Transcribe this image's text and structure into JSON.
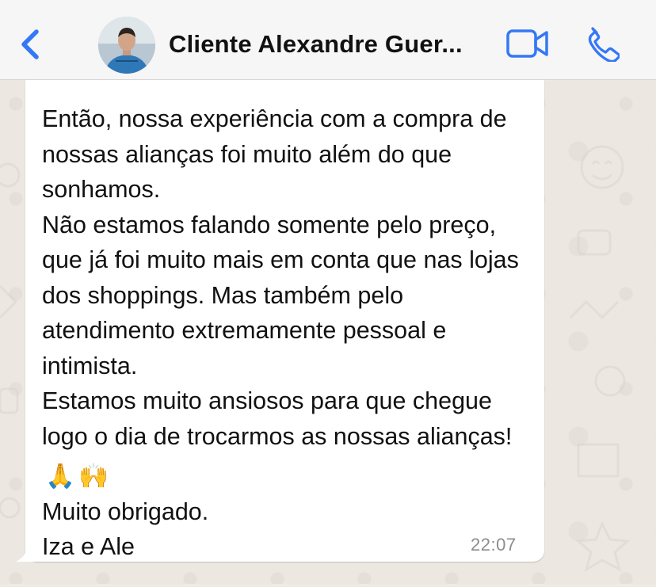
{
  "header": {
    "back_icon": "chevron-left-icon",
    "contact_name": "Cliente Alexandre Guer...",
    "video_icon": "video-camera-icon",
    "call_icon": "phone-icon"
  },
  "message": {
    "lines": [
      "Então, nossa experiência com a compra de nossas alianças foi muito além do que sonhamos.",
      "Não estamos falando somente pelo preço, que já foi muito mais em conta que nas lojas dos shoppings. Mas também pelo atendimento extremamente pessoal e intimista.",
      "Estamos muito ansiosos para que chegue logo o dia de trocarmos as nossas alianças!",
      "Muito obrigado.",
      "Iza e Ale"
    ],
    "emojis": [
      "🙏",
      "🙌"
    ],
    "time": "22:07"
  },
  "colors": {
    "accent": "#3478f6",
    "bubble": "#ffffff",
    "header_bg": "#f6f6f6",
    "wallpaper": "#ece8e1"
  }
}
